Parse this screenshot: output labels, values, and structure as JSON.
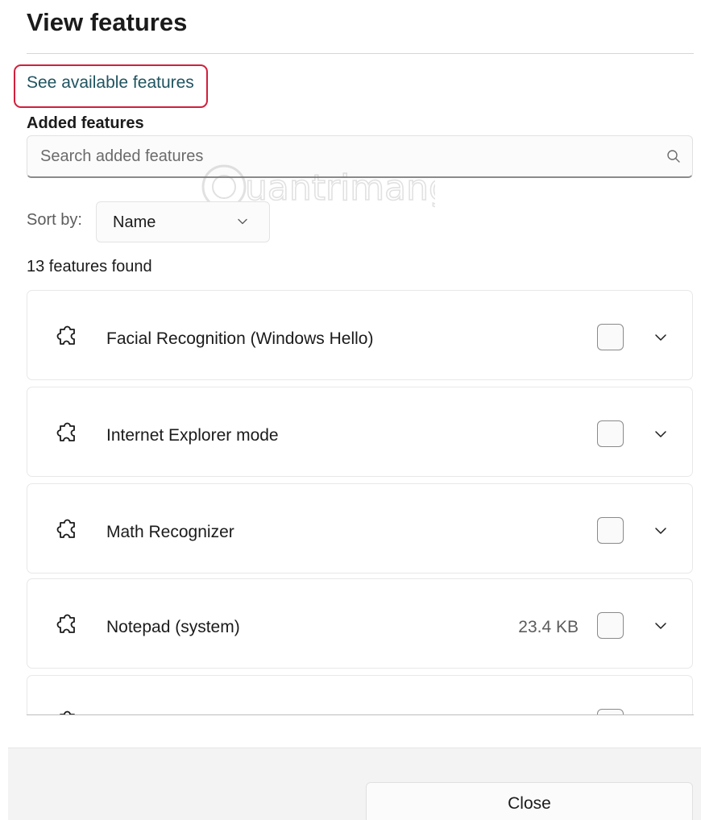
{
  "dialog": {
    "title": "View features",
    "see_available_link": "See available features",
    "section_label": "Added features",
    "search": {
      "placeholder": "Search added features",
      "value": ""
    },
    "sort": {
      "label": "Sort by:",
      "value": "Name"
    },
    "count_text": "13 features found",
    "features": [
      {
        "name": "Facial Recognition (Windows Hello)",
        "size": "",
        "checked": false
      },
      {
        "name": "Internet Explorer mode",
        "size": "",
        "checked": false
      },
      {
        "name": "Math Recognizer",
        "size": "",
        "checked": false
      },
      {
        "name": "Notepad (system)",
        "size": "23.4 KB",
        "checked": false
      },
      {
        "name": "",
        "size": "",
        "checked": false
      }
    ],
    "close_label": "Close"
  },
  "watermark": {
    "text": "uantrimang"
  },
  "colors": {
    "link": "#1f5460",
    "highlight_border": "#d21f3c",
    "footer_bg": "#f3f3f3"
  },
  "icons": {
    "feature": "puzzle-piece-icon",
    "search": "search-icon",
    "chevron": "chevron-down-icon"
  }
}
